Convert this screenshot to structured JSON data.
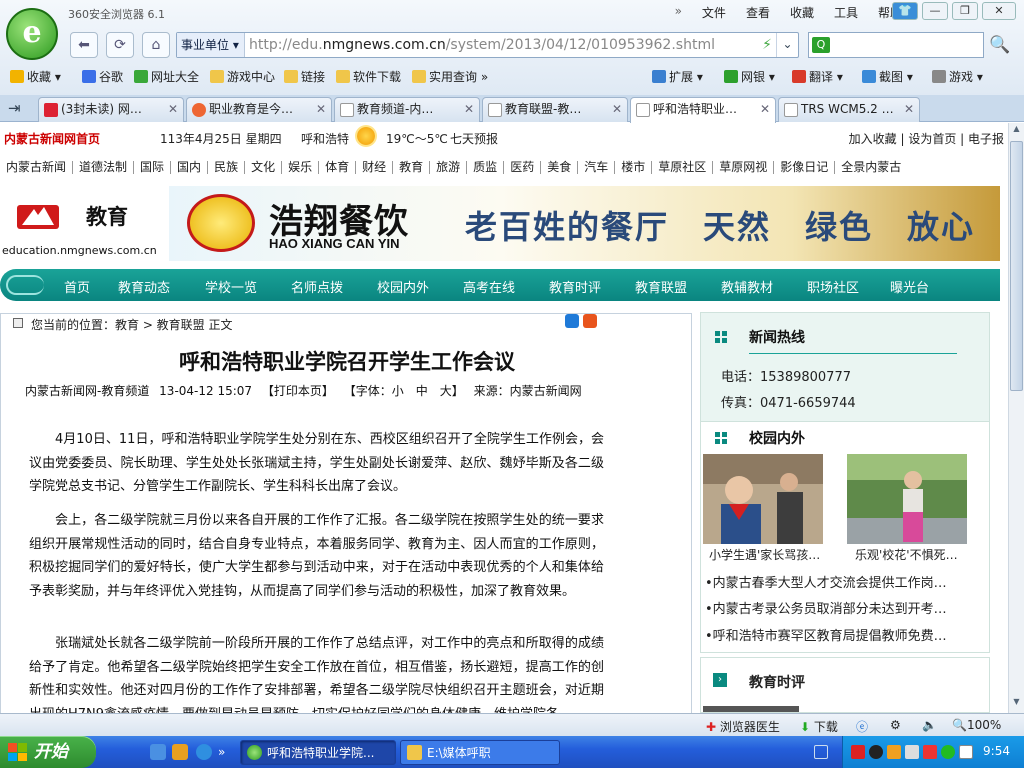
{
  "browser": {
    "app_title": "360安全浏览器 6.1",
    "menu": [
      "»",
      "文件",
      "查看",
      "收藏",
      "工具",
      "帮助"
    ],
    "window_buttons": {
      "minimize": "—",
      "restore": "❐",
      "close": "✕"
    },
    "zone_label": "事业单位",
    "url_prefix": "http://edu.",
    "url_domain": "nmgnews.com.cn",
    "url_path": "/system/2013/04/12/010953962.shtml",
    "search_placeholder": "",
    "favorites": [
      {
        "label": "收藏",
        "icon": "star-icon"
      },
      {
        "label": "谷歌",
        "icon": "google-icon"
      },
      {
        "label": "网址大全",
        "icon": "sites-icon"
      },
      {
        "label": "游戏中心",
        "icon": "folder-icon"
      },
      {
        "label": "链接",
        "icon": "folder-icon"
      },
      {
        "label": "软件下载",
        "icon": "folder-icon"
      },
      {
        "label": "实用查询",
        "icon": "folder-icon"
      }
    ],
    "toolbar_right": [
      "扩展",
      "网银",
      "翻译",
      "截图",
      "游戏"
    ],
    "tabs": [
      {
        "label": "(3封未读) 网…"
      },
      {
        "label": "职业教育是今…"
      },
      {
        "label": "教育频道-内…"
      },
      {
        "label": "教育联盟-教…"
      },
      {
        "label": "呼和浩特职业…"
      },
      {
        "label": "TRS WCM5.2 …"
      }
    ],
    "status": {
      "doctor": "浏览器医生",
      "download": "下载",
      "zoom": "100%"
    }
  },
  "site": {
    "home_link": "内蒙古新闻网首页",
    "date": "113年4月25日 星期四",
    "city": "呼和浩特",
    "temperature": "19℃～5℃",
    "forecast_link": "七天预报",
    "top_links": "加入收藏 | 设为首页 | 电子报",
    "sitenav": [
      "内蒙古新闻",
      "道德法制",
      "国际",
      "国内",
      "民族",
      "文化",
      "娱乐",
      "体育",
      "财经",
      "教育",
      "旅游",
      "质监",
      "医药",
      "美食",
      "汽车",
      "楼市",
      "草原社区",
      "草原网视",
      "影像日记",
      "全景内蒙古"
    ],
    "brand_title": "教育",
    "brand_url": "education.nmgnews.com.cn",
    "banner": {
      "cn": "浩翔餐饮",
      "en": "HAO XIANG CAN YIN",
      "slogan": "老百姓的餐厅　天然　绿色　放心"
    },
    "mainnav": [
      "首页",
      "教育动态",
      "学校一览",
      "名师点拨",
      "校园内外",
      "高考在线",
      "教育时评",
      "教育联盟",
      "教辅教材",
      "职场社区",
      "曝光台"
    ]
  },
  "article": {
    "breadcrumb": "您当前的位置：教育 > 教育联盟 正文",
    "title": "呼和浩特职业学院召开学生工作会议",
    "meta": [
      "内蒙古新闻网-教育频道",
      "13-04-12 15:07",
      "【打印本页】",
      "【字体：小　中　大】",
      "来源：内蒙古新闻网"
    ],
    "paragraphs": [
      "4月10日、11日，呼和浩特职业学院学生处分别在东、西校区组织召开了全院学生工作例会，会议由党委委员、院长助理、学生处处长张瑞斌主持，学生处副处长谢爱萍、赵欣、魏妤毕斯及各二级学院党总支书记、分管学生工作副院长、学生科科长出席了会议。",
      "会上，各二级学院就三月份以来各自开展的工作作了汇报。各二级学院在按照学生处的统一要求组织开展常规性活动的同时，结合自身专业特点，本着服务同学、教育为主、因人而宜的工作原则，积极挖掘同学们的爱好特长，使广大学生都参与到活动中来，对于在活动中表现优秀的个人和集体给予表彰奖励，并与年终评优入党挂钩，从而提高了同学们参与活动的积极性，加深了教育效果。",
      "张瑞斌处长就各二级学院前一阶段所开展的工作作了总结点评，对工作中的亮点和所取得的成绩给予了肯定。他希望各二级学院始终把学生安全工作放在首位，相互借鉴，扬长避短，提高工作的创新性和实效性。他还对四月份的工作作了安排部署，希望各二级学院尽快组织召开主题班会，对近期出现的H7N9禽流感疫情，要做到早动员早预防，切实保护好同学们的身体健康，维护学院各"
    ]
  },
  "sidebar": {
    "hotline_title": "新闻热线",
    "phone_label": "电话：",
    "phone": "15389800777",
    "fax_label": "传真：",
    "fax": "0471-6659744",
    "campus_title": "校园内外",
    "thumbs": [
      {
        "caption": "小学生遇'家长骂孩…"
      },
      {
        "caption": "乐观'校花'不惧死…"
      }
    ],
    "news": [
      "•内蒙古春季大型人才交流会提供工作岗…",
      "•内蒙古考录公务员取消部分未达到开考…",
      "•呼和浩特市赛罕区教育局提倡教师免费…"
    ],
    "commentary_title": "教育时评"
  },
  "taskbar": {
    "start": "开始",
    "tasks": [
      {
        "label": "呼和浩特职业学院..."
      },
      {
        "label": "E:\\媒体呼职"
      }
    ],
    "clock": "9:54"
  }
}
